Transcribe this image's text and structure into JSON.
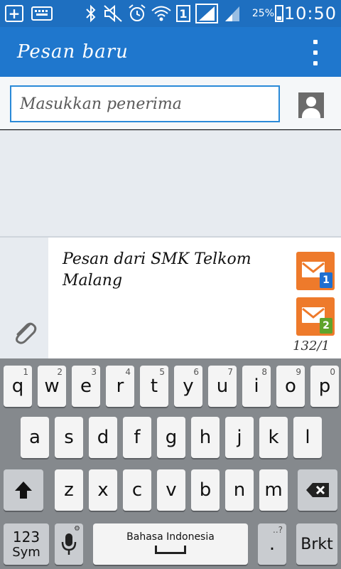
{
  "status_bar": {
    "sim_slot": "1",
    "battery": "25%",
    "time": "10:50"
  },
  "action_bar": {
    "title": "Pesan baru"
  },
  "recipient": {
    "placeholder": "Masukkan penerima"
  },
  "compose": {
    "message": "Pesan dari SMK Telkom Malang",
    "send_sim1_badge": "1",
    "send_sim2_badge": "2",
    "char_counter": "132/1"
  },
  "keyboard": {
    "row1": [
      {
        "key": "q",
        "hint": "1"
      },
      {
        "key": "w",
        "hint": "2"
      },
      {
        "key": "e",
        "hint": "3"
      },
      {
        "key": "r",
        "hint": "4"
      },
      {
        "key": "t",
        "hint": "5"
      },
      {
        "key": "y",
        "hint": "6"
      },
      {
        "key": "u",
        "hint": "7"
      },
      {
        "key": "i",
        "hint": "8"
      },
      {
        "key": "o",
        "hint": "9"
      },
      {
        "key": "p",
        "hint": "0"
      }
    ],
    "row2": [
      "a",
      "s",
      "d",
      "f",
      "g",
      "h",
      "j",
      "k",
      "l"
    ],
    "row3": [
      "z",
      "x",
      "c",
      "v",
      "b",
      "n",
      "m"
    ],
    "sym_label_top": "123",
    "sym_label_bottom": "Sym",
    "space_label": "Bahasa Indonesia",
    "period": ".",
    "period_hint": "..?",
    "enter_label": "Brkt"
  }
}
